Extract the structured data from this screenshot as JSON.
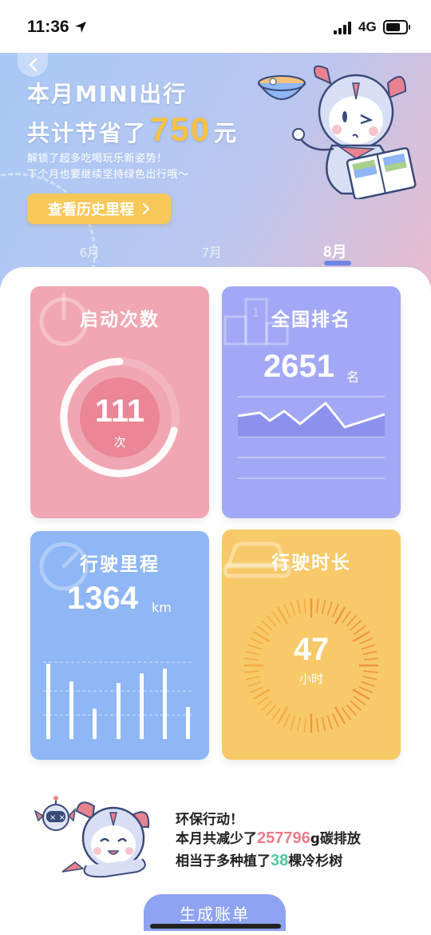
{
  "status_bar": {
    "time": "11:36",
    "network": "4G"
  },
  "header": {
    "title_line1": "本月MINI出行",
    "title_line2_prefix": "共计节省了",
    "saved_amount": "750",
    "title_line2_suffix": "元",
    "sub_line1": "解锁了超多吃喝玩乐新姿势！",
    "sub_line2": "下个月也要继续坚持绿色出行哦～",
    "history_button_label": "查看历史里程",
    "history_button_icon": "chevron-right-icon"
  },
  "month_tabs": [
    {
      "label": "6月",
      "active": false
    },
    {
      "label": "7月",
      "active": false
    },
    {
      "label": "8月",
      "active": true
    }
  ],
  "cards": {
    "start_count": {
      "title": "启动次数",
      "value": "111",
      "unit": "次",
      "icon": "power-icon",
      "color": "#f1a7b3"
    },
    "national_rank": {
      "title": "全国排名",
      "value": "2651",
      "unit": "名",
      "icon": "podium-icon",
      "color": "#a3a8f6"
    },
    "mileage": {
      "title": "行驶里程",
      "value": "1364",
      "unit": "km",
      "icon": "speedometer-icon",
      "color": "#8fb6f5"
    },
    "duration": {
      "title": "行驶时长",
      "value": "47",
      "unit": "小时",
      "icon": "car-icon",
      "color": "#f8c968"
    }
  },
  "eco": {
    "line1": "环保行动！",
    "line2_prefix": "本月共减少了",
    "co2_amount": "257796",
    "line2_suffix": "g碳排放",
    "line3_prefix": "相当于多种植了",
    "trees": "38",
    "line3_suffix": "棵冷杉树",
    "co2_color": "#f07a8a",
    "trees_color": "#55c79a"
  },
  "generate_button_label": "生成账单",
  "colors": {
    "accent_yellow": "#f7c244",
    "indicator": "#6f86e8"
  }
}
